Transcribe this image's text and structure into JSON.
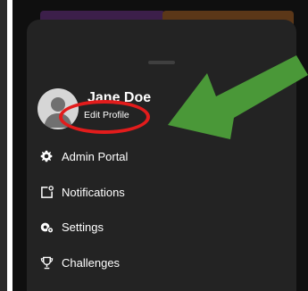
{
  "profile": {
    "name": "Jane Doe",
    "edit_label": "Edit Profile",
    "avatar_icon": "person-silhouette-icon"
  },
  "menu": {
    "items": [
      {
        "label": "Admin Portal",
        "icon": "gear-icon"
      },
      {
        "label": "Notifications",
        "icon": "notification-bell-icon"
      },
      {
        "label": "Settings",
        "icon": "settings-gears-icon"
      },
      {
        "label": "Challenges",
        "icon": "trophy-icon"
      }
    ]
  },
  "colors": {
    "sheet_background": "#232323",
    "page_background": "#0f0f0f",
    "annotation_circle": "#e21c1c",
    "annotation_arrow": "#4a9838",
    "tile_purple": "#3c1f4a",
    "tile_orange": "#5b3718"
  }
}
